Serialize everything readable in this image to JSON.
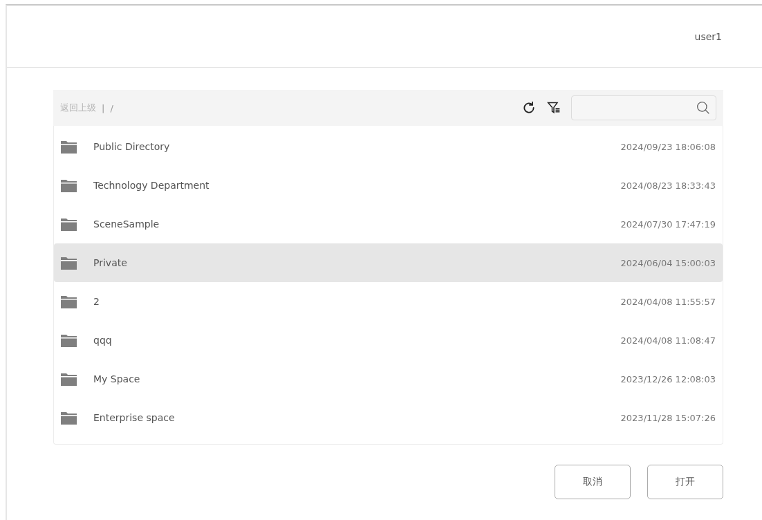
{
  "header": {
    "user": "user1"
  },
  "toolbar": {
    "back": "返回上级",
    "separator": "|",
    "path": "/"
  },
  "files": [
    {
      "name": "Public Directory",
      "modified": "2024/09/23 18:06:08",
      "selected": false
    },
    {
      "name": "Technology Department",
      "modified": "2024/08/23 18:33:43",
      "selected": false
    },
    {
      "name": "SceneSample",
      "modified": "2024/07/30 17:47:19",
      "selected": false
    },
    {
      "name": "Private",
      "modified": "2024/06/04 15:00:03",
      "selected": true
    },
    {
      "name": "2",
      "modified": "2024/04/08 11:55:57",
      "selected": false
    },
    {
      "name": "qqq",
      "modified": "2024/04/08 11:08:47",
      "selected": false
    },
    {
      "name": "My Space",
      "modified": "2023/12/26 12:08:03",
      "selected": false
    },
    {
      "name": "Enterprise space",
      "modified": "2023/11/28 15:07:26",
      "selected": false
    }
  ],
  "buttons": [
    "取消",
    "打开"
  ]
}
